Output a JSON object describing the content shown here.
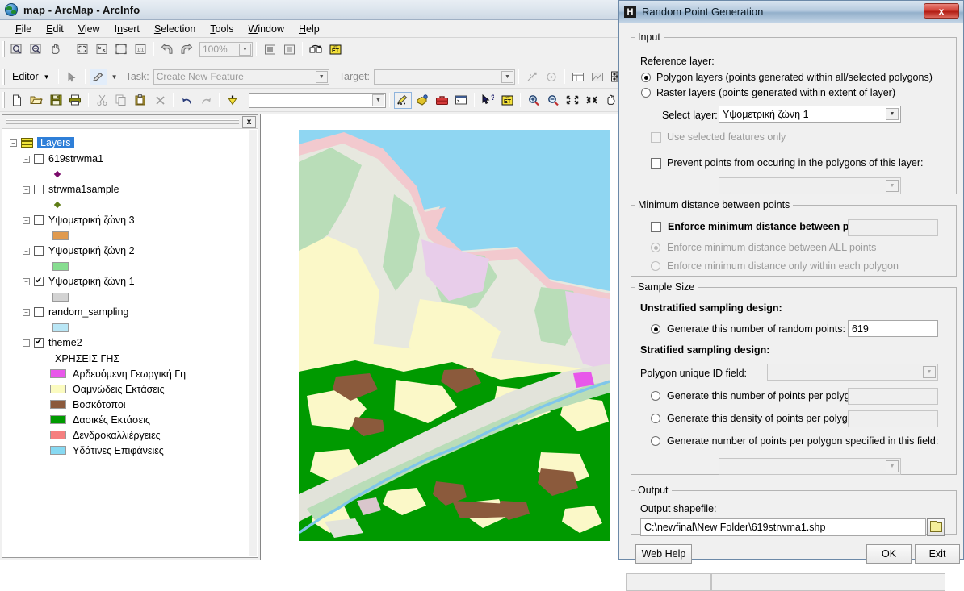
{
  "window": {
    "title": "map - ArcMap - ArcInfo",
    "app_icon": "globe-icon"
  },
  "menu": {
    "items": [
      "File",
      "Edit",
      "View",
      "Insert",
      "Selection",
      "Tools",
      "Window",
      "Help"
    ]
  },
  "toolbars": {
    "standard_zoom_value": "100%",
    "editor": {
      "menu_label": "Editor",
      "task_label": "Task:",
      "task_value": "Create New Feature",
      "target_label": "Target:",
      "target_value": ""
    },
    "file_combo_value": ""
  },
  "toc": {
    "panel_close": "x",
    "root": {
      "label": "Layers",
      "selected": true,
      "icon": "layers-icon"
    },
    "items": [
      {
        "label": "619strwma1",
        "checked": false,
        "symbol_type": "point",
        "symbol_color": "#7b0b6b"
      },
      {
        "label": "strwma1sample",
        "checked": false,
        "symbol_type": "point",
        "symbol_color": "#5f7d16"
      },
      {
        "label": "Υψομετρική ζώνη 3",
        "checked": false,
        "symbol_type": "fill",
        "symbol_color": "#e09a4e"
      },
      {
        "label": "Υψομετρική ζώνη 2",
        "checked": false,
        "symbol_type": "fill",
        "symbol_color": "#87dd90"
      },
      {
        "label": "Υψομετρική ζώνη 1",
        "checked": true,
        "symbol_type": "fill",
        "symbol_color": "#d3d3d3"
      },
      {
        "label": "random_sampling",
        "checked": false,
        "symbol_type": "fill",
        "symbol_color": "#b9e6f5"
      },
      {
        "label": "theme2",
        "checked": true,
        "symbol_type": "none",
        "symbol_color": ""
      }
    ],
    "theme2_legend": {
      "heading": "ΧΡΗΣΕΙΣ ΓΗΣ",
      "entries": [
        {
          "label": "Αρδευόμενη Γεωργική Γη",
          "color": "#e858ea"
        },
        {
          "label": "Θαμνώδεις Εκτάσεις",
          "color": "#fbfbc0"
        },
        {
          "label": "Βοσκότοποι",
          "color": "#8b5a3c"
        },
        {
          "label": "Δασικές Εκτάσεις",
          "color": "#009a00"
        },
        {
          "label": "Δενδροκαλλιέργειες",
          "color": "#f57f7f"
        },
        {
          "label": "Υδάτινες Επιφάνειες",
          "color": "#87d9f2"
        }
      ]
    }
  },
  "map": {
    "sea_color": "#8fd6f2",
    "river_color": "#7fc6ea"
  },
  "dialog": {
    "title": "Random Point Generation",
    "icon_letter": "H",
    "close_label": "x",
    "input": {
      "legend": "Input",
      "reference_layer_label": "Reference layer:",
      "option_polygon": "Polygon layers (points generated within all/selected polygons)",
      "option_raster": "Raster layers (points generated within extent of layer)",
      "selected_reference": "polygon",
      "select_layer_label": "Select layer:",
      "select_layer_value": "Υψομετρική ζώνη 1",
      "use_selected_features_label": "Use selected features only",
      "use_selected_features_checked": false,
      "prevent_points_label": "Prevent points from occuring in the polygons of this layer:",
      "prevent_points_checked": false,
      "prevent_points_value": ""
    },
    "min_distance": {
      "legend": "Minimum distance between points",
      "enforce_label": "Enforce minimum distance between points:",
      "enforce_checked": false,
      "enforce_value": "",
      "option_all": "Enforce minimum distance between ALL points",
      "option_within": "Enforce minimum distance only within each polygon",
      "selected_option": "all"
    },
    "sample_size": {
      "legend": "Sample Size",
      "unstratified_heading": "Unstratified sampling design:",
      "generate_number_label": "Generate this number of random points:",
      "generate_number_value": "619",
      "stratified_heading": "Stratified sampling design:",
      "polygon_id_label": "Polygon unique ID field:",
      "polygon_id_value": "",
      "points_per_polygon_label": "Generate this number of points per polygon:",
      "points_per_polygon_value": "",
      "density_per_polygon_label": "Generate this density of points per polygon:",
      "density_per_polygon_value": "",
      "field_specified_label": "Generate number of points per polygon specified in this field:",
      "field_specified_value": "",
      "selected_option": "generate_number"
    },
    "output": {
      "legend": "Output",
      "shapefile_label": "Output shapefile:",
      "shapefile_value": "C:\\newfinal\\New Folder\\619strwma1.shp",
      "browse_icon": "folder-icon"
    },
    "buttons": {
      "web_help": "Web Help",
      "ok": "OK",
      "exit": "Exit"
    }
  }
}
